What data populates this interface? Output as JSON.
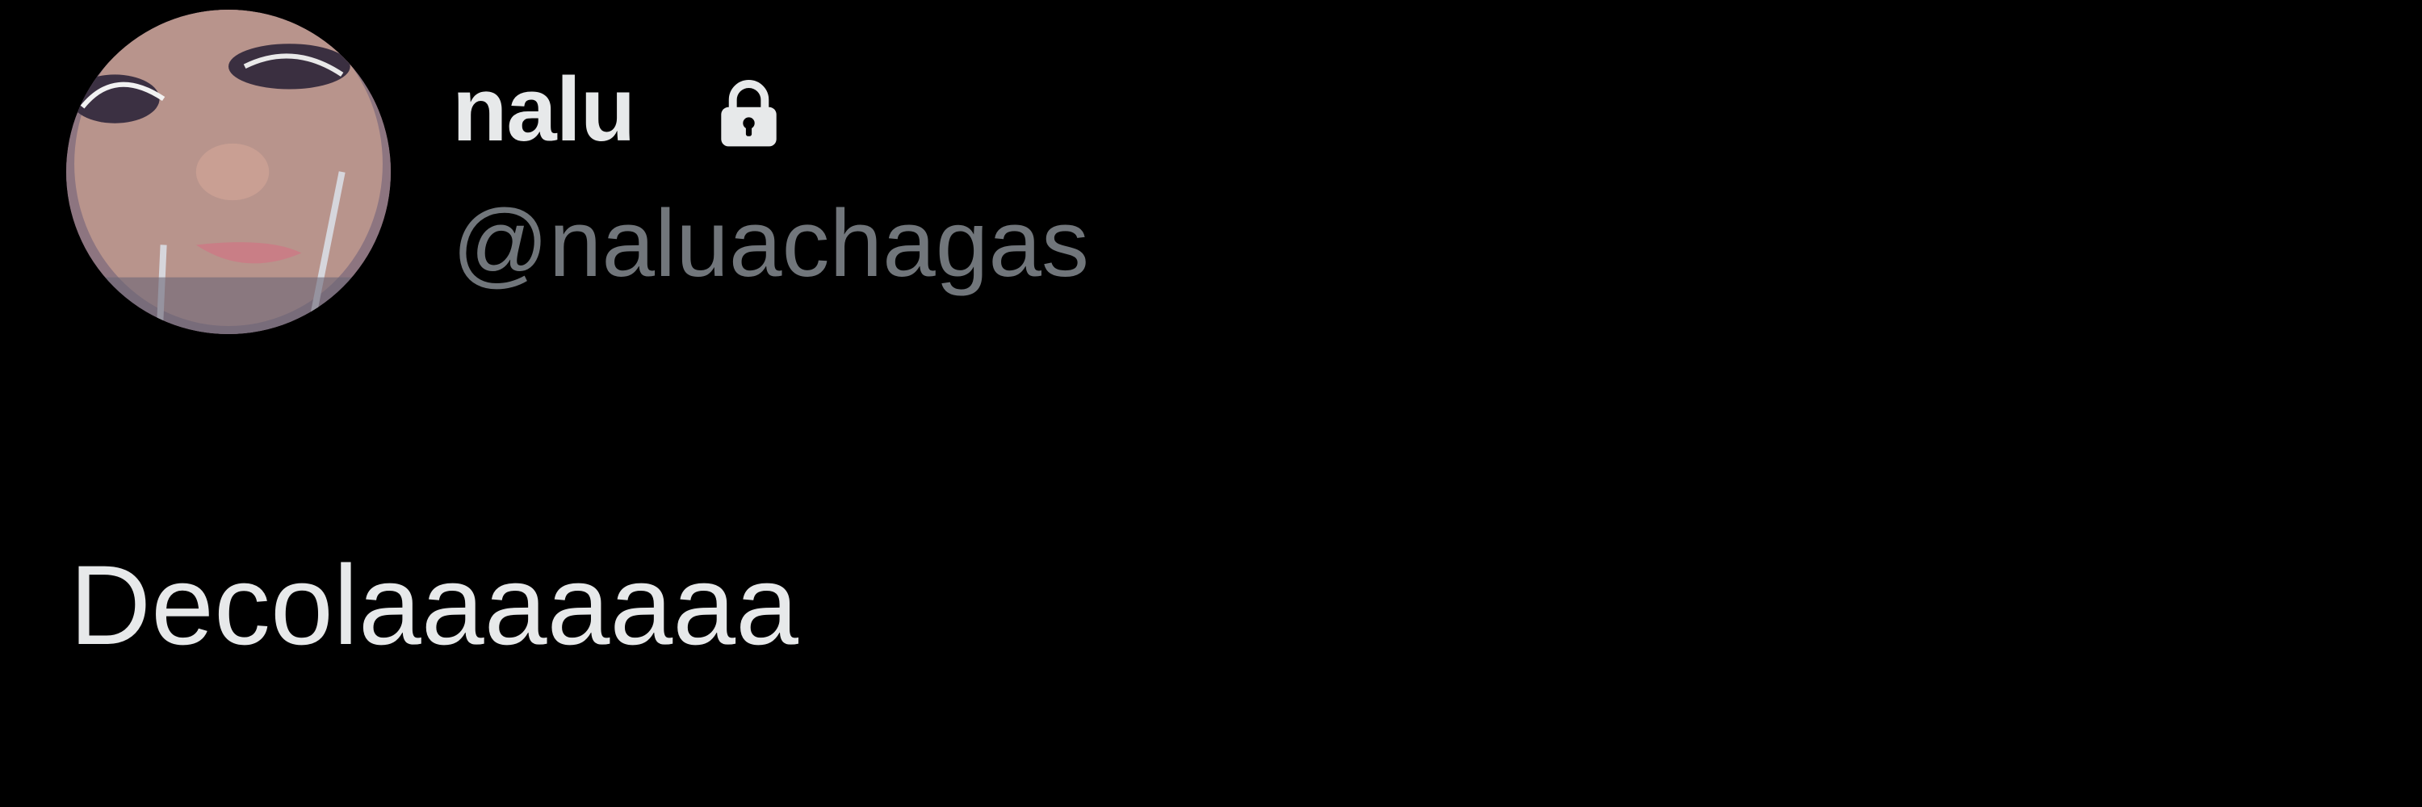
{
  "tweet": {
    "author": {
      "display_name": "nalu",
      "handle": "@naluachagas",
      "protected_icon": "lock-icon",
      "avatar": "avatar-photo"
    },
    "text": "Decolaaaaaaa"
  },
  "colors": {
    "background": "#000000",
    "primary_text": "#e7e9ea",
    "secondary_text": "#71767b"
  }
}
